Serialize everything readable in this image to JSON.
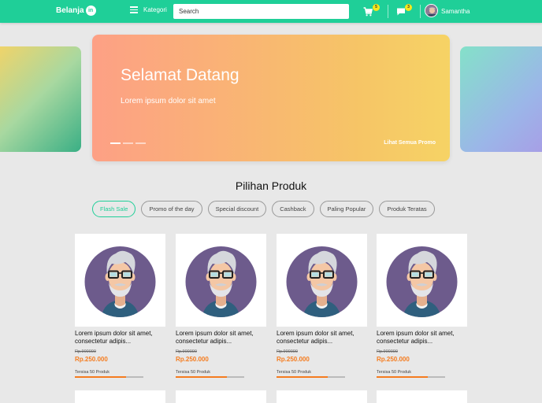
{
  "navbar": {
    "brand": "Belanja",
    "brand_badge": "in",
    "kategori": "Kategori",
    "search_placeholder": "Search",
    "cart_count": "5",
    "chat_count": "3",
    "username": "Samantha",
    "color": "#1fcf98"
  },
  "hero": {
    "title": "Selamat Datang",
    "subtitle": "Lorem ipsum dolor sit amet",
    "link": "Lihat Semua Promo"
  },
  "section": {
    "title": "Pilihan Produk",
    "chips": [
      "Flash Sale",
      "Promo of the day",
      "Special discount",
      "Cashback",
      "Paling Popular",
      "Produk Teratas"
    ],
    "active_chip": "Flash Sale"
  },
  "products": [
    {
      "name": "Lorem ipsum dolor sit amet, consectetur adipis...",
      "old_price": "Rp.900000",
      "price": "Rp.250.000",
      "stock": "Tersisa 50 Produk",
      "stock_level": 0.75
    },
    {
      "name": "Lorem ipsum dolor sit amet, consectetur adipis...",
      "old_price": "Rp.900000",
      "price": "Rp.250.000",
      "stock": "Tersisa 50 Produk",
      "stock_level": 0.75
    },
    {
      "name": "Lorem ipsum dolor sit amet, consectetur adipis...",
      "old_price": "Rp.900000",
      "price": "Rp.250.000",
      "stock": "Tersisa 50 Produk",
      "stock_level": 0.75
    },
    {
      "name": "Lorem ipsum dolor sit amet, consectetur adipis...",
      "old_price": "Rp.900000",
      "price": "Rp.250.000",
      "stock": "Tersisa 50 Produk",
      "stock_level": 0.75
    }
  ],
  "colors": {
    "accent": "#1fcf98",
    "price": "#f57c1f",
    "avatar_bg": "#7a6a8a"
  }
}
